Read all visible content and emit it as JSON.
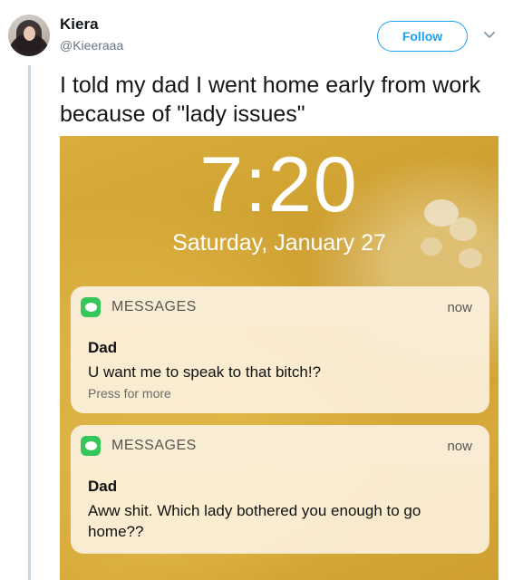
{
  "tweet": {
    "author_name": "Kiera",
    "author_handle": "@Kieeraaa",
    "follow_label": "Follow",
    "text": "I told my dad I went home early from work because of \"lady issues\""
  },
  "lockscreen": {
    "time": "7:20",
    "date": "Saturday, January 27",
    "notifications": [
      {
        "app": "MESSAGES",
        "when": "now",
        "sender": "Dad",
        "message": "U want me to speak to that bitch!?",
        "hint": "Press for more"
      },
      {
        "app": "MESSAGES",
        "when": "now",
        "sender": "Dad",
        "message": "Aww shit. Which lady bothered you enough to go home??"
      }
    ]
  },
  "colors": {
    "accent": "#1da1f2",
    "messages_icon": "#34c759",
    "photo_background": "#d4a537"
  },
  "icons": [
    "avatar",
    "chevron-down-icon",
    "messages-app-icon"
  ]
}
